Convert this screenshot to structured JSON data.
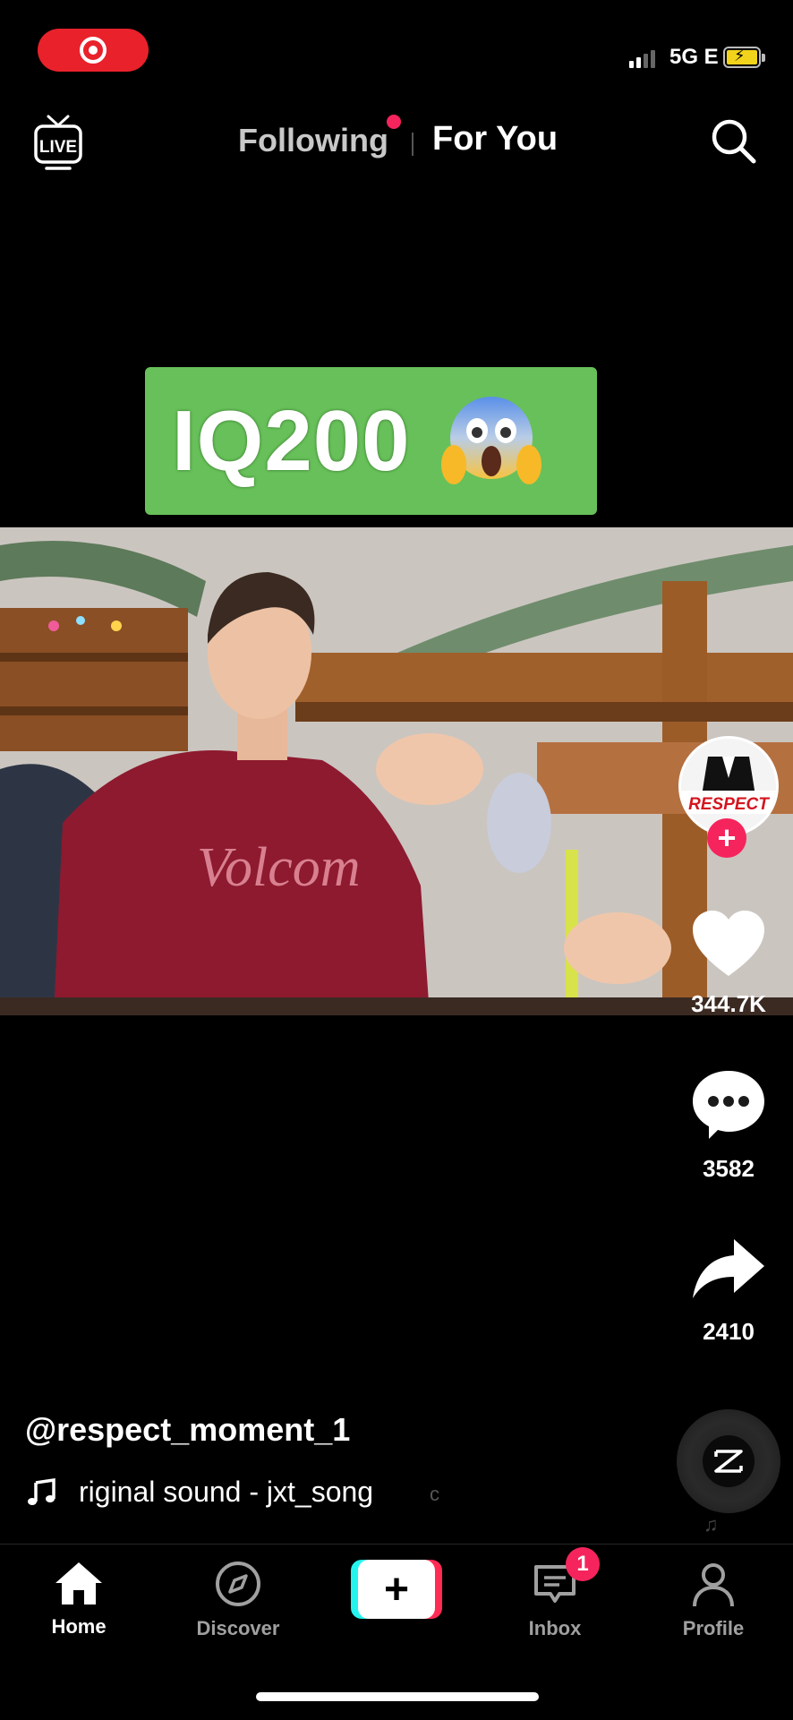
{
  "status_bar": {
    "network": "5G E"
  },
  "top_nav": {
    "live_label": "LIVE",
    "tab_following": "Following",
    "tab_for_you": "For You"
  },
  "video": {
    "caption_banner": "IQ200",
    "caption_emoji_icon": "screaming-face-emoji",
    "shirt_text": "Volcom",
    "avatar_text": "RESPECT"
  },
  "actions": {
    "likes": "344.7K",
    "comments": "3582",
    "shares": "2410"
  },
  "post": {
    "username": "@respect_moment_1",
    "sound": "riginal sound - jxt_song",
    "sound_tail": "c"
  },
  "bottom_nav": {
    "home": "Home",
    "discover": "Discover",
    "inbox": "Inbox",
    "inbox_badge": "1",
    "profile": "Profile"
  },
  "colors": {
    "accent": "#fe2c55",
    "cyan": "#25f4ee",
    "banner_green": "#68c05a",
    "record_red": "#e9212b"
  }
}
